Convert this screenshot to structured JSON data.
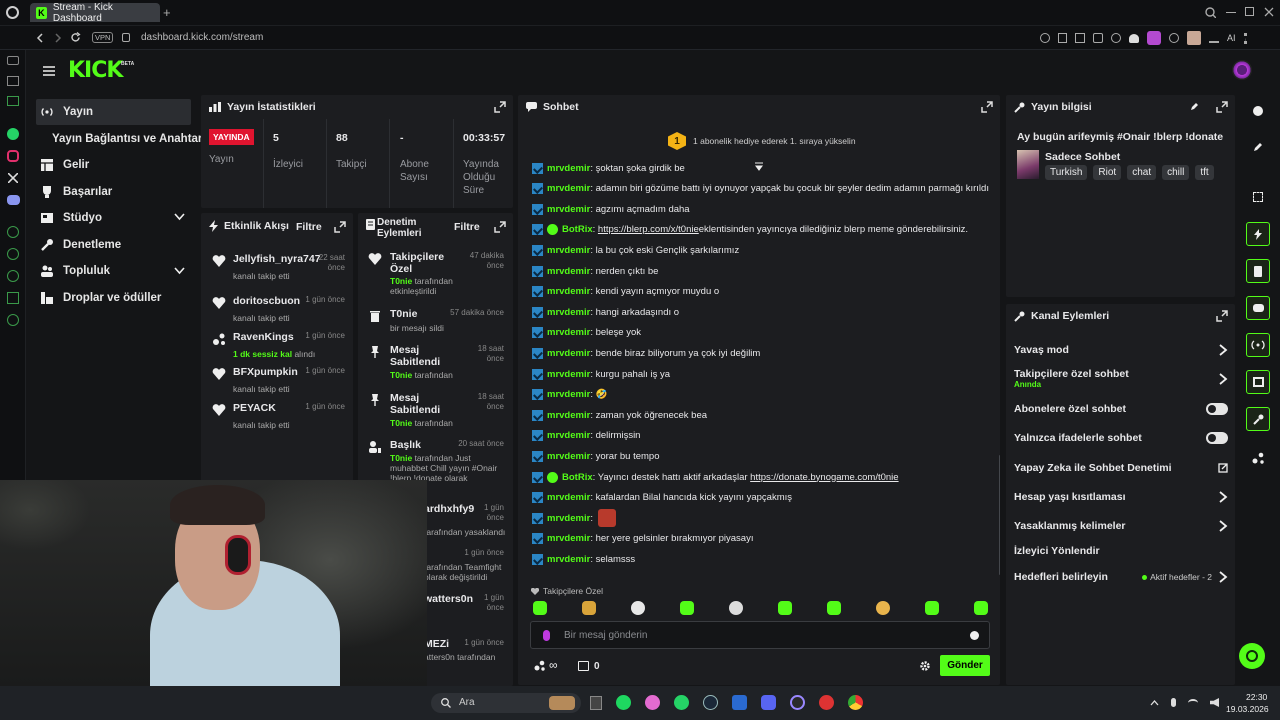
{
  "browser": {
    "tab_title": "Stream - Kick Dashboard",
    "new_tab": "+",
    "vpn": "VPN",
    "url": "dashboard.kick.com/stream",
    "ai_label": "AI"
  },
  "app": {
    "logo": "KICK",
    "logo_beta": "BETA"
  },
  "sidebar": {
    "items": [
      {
        "label": "Yayın",
        "icon": "broadcast-icon"
      },
      {
        "label": "Yayın Bağlantısı ve Anahtarı",
        "icon": ""
      },
      {
        "label": "Gelir",
        "icon": "revenue-icon"
      },
      {
        "label": "Başarılar",
        "icon": "trophy-icon"
      },
      {
        "label": "Stüdyo",
        "icon": "studio-icon"
      },
      {
        "label": "Denetleme",
        "icon": "wrench-icon"
      },
      {
        "label": "Topluluk",
        "icon": "community-icon"
      },
      {
        "label": "Droplar ve ödüller",
        "icon": "drops-icon"
      }
    ]
  },
  "stats": {
    "title": "Yayın İstatistikleri",
    "live_badge": "YAYINDA",
    "items": [
      {
        "value": "",
        "label": "Yayın"
      },
      {
        "value": "5",
        "label": "İzleyici"
      },
      {
        "value": "88",
        "label": "Takipçi"
      },
      {
        "value": "-",
        "label": "Abone Sayısı"
      },
      {
        "value": "00:33:57",
        "label": "Yayında Olduğu Süre"
      }
    ]
  },
  "activity": {
    "title": "Etkinlik Akışı",
    "filter": "Filtre",
    "items": [
      {
        "name": "Jellyfish_nyra747",
        "sub": "kanalı takip etti",
        "time": "22 saat önce",
        "icon": "heart-icon"
      },
      {
        "name": "doritoscbuon",
        "sub": "kanalı takip etti",
        "time": "1 gün önce",
        "icon": "heart-icon"
      },
      {
        "name": "RavenKings",
        "sub_green": "1 dk sessiz kal",
        "sub": " alındı",
        "time": "1 gün önce",
        "icon": "raid-icon"
      },
      {
        "name": "BFXpumpkin",
        "sub": "kanalı takip etti",
        "time": "1 gün önce",
        "icon": "heart-icon"
      },
      {
        "name": "PEYACK",
        "sub": "kanalı takip etti",
        "time": "1 gün önce",
        "icon": "heart-icon"
      }
    ]
  },
  "mod": {
    "title": "Denetim Eylemleri",
    "filter": "Filtre",
    "items": [
      {
        "name": "Takipçilere Özel",
        "actor": "T0nie",
        "sub": " tarafından etkinleştirildi",
        "time": "47 dakika önce"
      },
      {
        "name": "T0nie",
        "sub": "bir mesajı sildi",
        "time": "57 dakika önce"
      },
      {
        "name": "Mesaj Sabitlendi",
        "actor": "T0nie",
        "sub": " tarafından",
        "time": "18 saat önce"
      },
      {
        "name": "Mesaj Sabitlendi",
        "actor": "T0nie",
        "sub": " tarafından",
        "time": "18 saat önce"
      },
      {
        "name": "Başlık",
        "actor": "T0nie",
        "sub": " tarafından Just muhabbet Chill yayın #Onair !blerp !donate olarak",
        "time": "20 saat önce"
      },
      {
        "name": "ardhxhfy9",
        "sub": "tarafından yasaklandı",
        "time": "1 gün önce"
      },
      {
        "name": "i",
        "sub": "tarafından Teamfight olarak değiştirildi",
        "sub_green": "Teamfight",
        "time": "1 gün önce"
      },
      {
        "name": "watters0n",
        "sub": "",
        "time": "1 gün önce"
      },
      {
        "name": "MEZi",
        "sub": "atters0n tarafından",
        "time": "1 gün önce"
      }
    ]
  },
  "chat": {
    "title": "Sohbet",
    "pinned_num": "1",
    "pinned_text": "1 abonelik hediye ederek 1. sıraya yükselin",
    "lines": [
      {
        "user": "mrvdemir",
        "text": ": şoktan şoka girdik be",
        "bot": false
      },
      {
        "user": "mrvdemir",
        "text": ": adamın biri gözüme battı iyi oynuyor yapçak bu çocuk bir şeyler dedim adamın parmağı kırıldı",
        "bot": false
      },
      {
        "user": "mrvdemir",
        "text": ": agzımı açmadım daha",
        "bot": false
      },
      {
        "user": "BotRix",
        "text": ": ",
        "link": "https://blerp.com/x/t0nie",
        "after": " eklentisinden yayıncıya dilediğiniz blerp meme gönderebilirsiniz.",
        "bot": true
      },
      {
        "user": "mrvdemir",
        "text": ": la bu çok eski Gençlik şarkılarımız",
        "bot": false
      },
      {
        "user": "mrvdemir",
        "text": ": nerden çıktı be",
        "bot": false
      },
      {
        "user": "mrvdemir",
        "text": ": kendi yayın açmıyor muydu o",
        "bot": false
      },
      {
        "user": "mrvdemir",
        "text": ": hangi arkadaşındı o",
        "bot": false
      },
      {
        "user": "mrvdemir",
        "text": ": beleşe yok",
        "bot": false
      },
      {
        "user": "mrvdemir",
        "text": ": bende biraz biliyorum ya çok iyi değilim",
        "bot": false
      },
      {
        "user": "mrvdemir",
        "text": ": kurgu pahalı iş ya",
        "bot": false
      },
      {
        "user": "mrvdemir",
        "text": ": 🤣",
        "bot": false
      },
      {
        "user": "mrvdemir",
        "text": ": zaman yok öğrenecek bea",
        "bot": false
      },
      {
        "user": "mrvdemir",
        "text": ": delirmişsin",
        "bot": false
      },
      {
        "user": "mrvdemir",
        "text": ": yorar bu tempo",
        "bot": false
      },
      {
        "user": "BotRix",
        "text": ": Yayıncı destek hattı aktif arkadaşlar ",
        "link": "https://donate.bynogame.com/t0nie",
        "after": "",
        "bot": true
      },
      {
        "user": "mrvdemir",
        "text": ": kafalardan Bilal hancıda kick yayını yapçakmış",
        "bot": false
      },
      {
        "user": "mrvdemir",
        "text": ": ",
        "bot": false,
        "emote": true
      },
      {
        "user": "mrvdemir",
        "text": ": her yere gelsinler bırakmıyor piyasayı",
        "bot": false
      },
      {
        "user": "mrvdemir",
        "text": ": selamsss",
        "bot": false
      }
    ],
    "followers_only": "Takipçilere Özel",
    "input_placeholder": "Bir mesaj gönderin",
    "count": "0",
    "send": "Gönder"
  },
  "stream_info": {
    "title": "Yayın bilgisi",
    "stream_title": "Ay bugün arifeymiş #Onair !blerp !donate",
    "category": "Sadece Sohbet",
    "tags": [
      "Turkish",
      "Riot",
      "chat",
      "chill",
      "tft"
    ]
  },
  "channel_actions": {
    "title": "Kanal Eylemleri",
    "rows": [
      {
        "label": "Yavaş mod",
        "control": "chevron"
      },
      {
        "label": "Takipçilere özel sohbet",
        "sub": "Anında",
        "control": "chevron"
      },
      {
        "label": "Abonelere özel sohbet",
        "control": "toggle"
      },
      {
        "label": "Yalnızca ifadelerle sohbet",
        "control": "toggle"
      },
      {
        "label": "Yapay Zeka ile Sohbet Denetimi",
        "control": "external"
      },
      {
        "label": "Hesap yaşı kısıtlaması",
        "control": "chevron"
      },
      {
        "label": "Yasaklanmış kelimeler",
        "control": "chevron"
      },
      {
        "label": "İzleyici Yönlendir",
        "control": "none"
      },
      {
        "label": "Hedefleri belirleyin",
        "control": "chevron",
        "status": "Aktif hedefler - 2"
      }
    ]
  },
  "taskbar": {
    "search": "Ara",
    "time": "22:30",
    "date": "19.03.2026"
  },
  "colors": {
    "accent": "#53fc18",
    "live": "#e0142f",
    "bg": "#141517",
    "panel": "#1c1d20"
  }
}
